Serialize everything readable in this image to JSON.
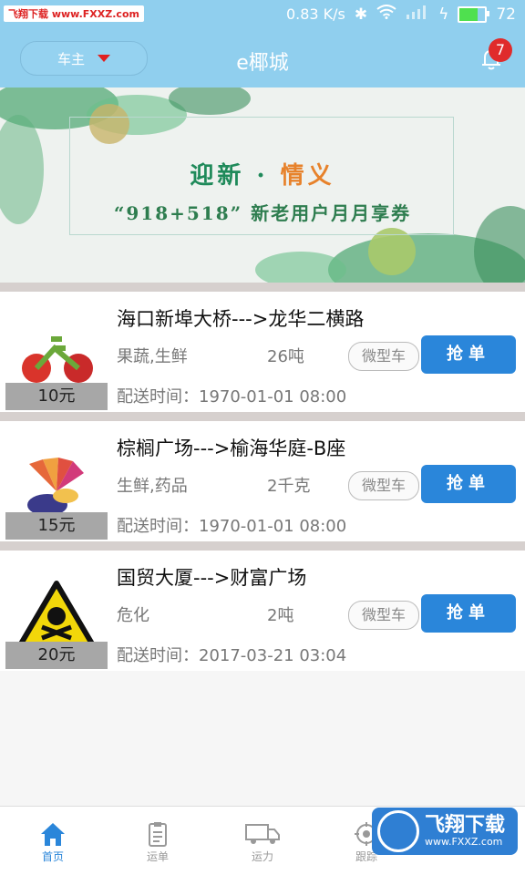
{
  "status_bar": {
    "watermark": "飞翔下载 www.FXXZ.com",
    "speed": "0.83 K/s",
    "battery": "72"
  },
  "header": {
    "role_label": "车主",
    "title": "e椰城",
    "notification_count": "7"
  },
  "banner": {
    "line1a": "迎新",
    "line1sep": "·",
    "line1b": "情义",
    "line2": "“918+518” 新老用户月月享券"
  },
  "orders": [
    {
      "route": "海口新埠大桥--->龙华二横路",
      "goods": "果蔬,生鲜",
      "weight": "26吨",
      "vehicle": "微型车",
      "button": "抢单",
      "time": "配送时间：1970-01-01 08:00",
      "price": "10元",
      "image": "bike-veggies-image"
    },
    {
      "route": "棕榈广场--->榆海华庭-B座",
      "goods": "生鲜,药品",
      "weight": "2千克",
      "vehicle": "微型车",
      "button": "抢单",
      "time": "配送时间：1970-01-01 08:00",
      "price": "15元",
      "image": "seafood-fan-image"
    },
    {
      "route": "国贸大厦--->财富广场",
      "goods": "危化",
      "weight": "2吨",
      "vehicle": "微型车",
      "button": "抢单",
      "time": "配送时间：2017-03-21 03:04",
      "price": "20元",
      "image": "toxic-warning-image"
    }
  ],
  "tabs": [
    {
      "label": "首页",
      "icon": "home-icon",
      "active": true
    },
    {
      "label": "运单",
      "icon": "clipboard-icon",
      "active": false
    },
    {
      "label": "运力",
      "icon": "truck-icon",
      "active": false
    },
    {
      "label": "跟踪",
      "icon": "target-icon",
      "active": false
    }
  ],
  "corner_logo": {
    "title": "飞翔下载",
    "url": "www.FXXZ.com"
  },
  "colors": {
    "header": "#90cfee",
    "button": "#2a86da",
    "badge": "#e02b2b"
  }
}
